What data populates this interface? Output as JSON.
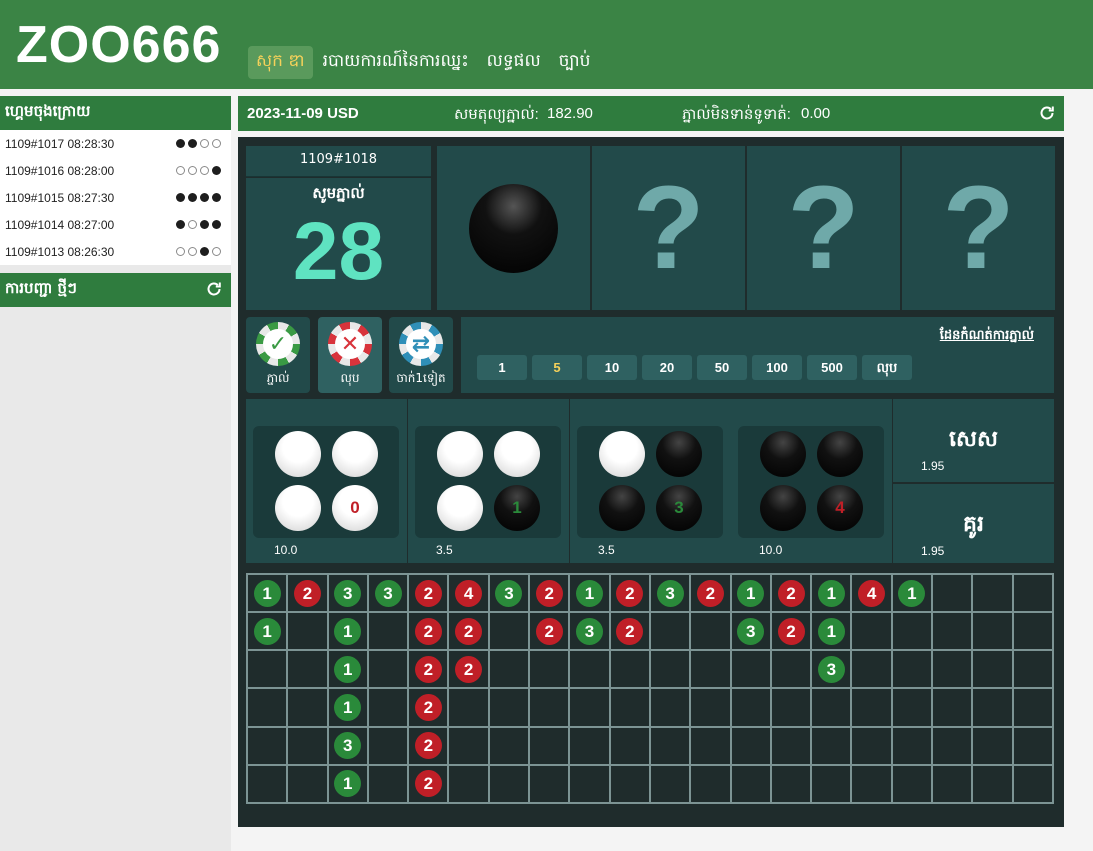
{
  "header": {
    "logo": "ZOO666",
    "nav": [
      {
        "label": "សុក ឌា",
        "active": true
      },
      {
        "label": "របាយការណ៍នៃការឈ្នះ",
        "active": false
      },
      {
        "label": "លទ្ធផល",
        "active": false
      },
      {
        "label": "ច្បាប់",
        "active": false
      }
    ]
  },
  "sidebar": {
    "recent_title": "ហ្គេមចុងក្រោយ",
    "recent": [
      {
        "id": "1109#1017 08:28:30",
        "dots": [
          "b",
          "b",
          "w",
          "w"
        ]
      },
      {
        "id": "1109#1016 08:28:00",
        "dots": [
          "w",
          "w",
          "w",
          "b"
        ]
      },
      {
        "id": "1109#1015 08:27:30",
        "dots": [
          "b",
          "b",
          "b",
          "b"
        ]
      },
      {
        "id": "1109#1014 08:27:00",
        "dots": [
          "b",
          "w",
          "b",
          "b"
        ]
      },
      {
        "id": "1109#1013 08:26:30",
        "dots": [
          "w",
          "w",
          "b",
          "w"
        ]
      }
    ],
    "orders_title": "ការបញ្ជា ថ្មីៗ"
  },
  "topbar": {
    "date_currency": "2023-11-09 USD",
    "balance_label": "សមតុល្យភ្នាល់:",
    "balance_value": "182.90",
    "unsettled_label": "ភ្នាល់មិនទាន់ទូទាត់:",
    "unsettled_value": "0.00"
  },
  "round": {
    "id": "1109#1018",
    "countdown_label": "សូមភ្នាល់",
    "countdown": "28",
    "slots": [
      "black",
      "?",
      "?",
      "?"
    ]
  },
  "actions": [
    {
      "label": "ភ្នាល់",
      "icon": "check-icon"
    },
    {
      "label": "លុប",
      "icon": "cross-icon"
    },
    {
      "label": "ចាក់1ទៀត",
      "icon": "repeat-icon"
    }
  ],
  "bet": {
    "limit_label": "ដែនកំណត់ការភ្នាល់",
    "amounts": [
      "1",
      "5",
      "10",
      "20",
      "50",
      "100",
      "500",
      "លុប"
    ],
    "selected": "5"
  },
  "options": [
    {
      "balls": [
        "w",
        "w",
        "w",
        "w"
      ],
      "count": "0",
      "count_color": "#c01f27",
      "odds": "10.0"
    },
    {
      "balls": [
        "w",
        "w",
        "w",
        "b"
      ],
      "count": "1",
      "count_color": "#2a8a3a",
      "odds": "3.5"
    },
    {
      "balls": [
        "w",
        "b",
        "b",
        "b"
      ],
      "count": "3",
      "count_color": "#2a8a3a",
      "odds": "3.5"
    },
    {
      "balls": [
        "b",
        "b",
        "b",
        "b"
      ],
      "count": "4",
      "count_color": "#c01f27",
      "odds": "10.0"
    }
  ],
  "odd_even": [
    {
      "label": "សេស",
      "odds": "1.95"
    },
    {
      "label": "គូរ",
      "odds": "1.95"
    }
  ],
  "road": [
    [
      {
        "v": "1",
        "c": "g"
      },
      {
        "v": "2",
        "c": "r"
      },
      {
        "v": "3",
        "c": "g"
      },
      {
        "v": "3",
        "c": "g"
      },
      {
        "v": "2",
        "c": "r"
      },
      {
        "v": "4",
        "c": "r"
      },
      {
        "v": "3",
        "c": "g"
      },
      {
        "v": "2",
        "c": "r"
      },
      {
        "v": "1",
        "c": "g"
      },
      {
        "v": "2",
        "c": "r"
      },
      {
        "v": "3",
        "c": "g"
      },
      {
        "v": "2",
        "c": "r"
      },
      {
        "v": "1",
        "c": "g"
      },
      {
        "v": "2",
        "c": "r"
      },
      {
        "v": "1",
        "c": "g"
      },
      {
        "v": "4",
        "c": "r"
      },
      {
        "v": "1",
        "c": "g"
      },
      null,
      null,
      null
    ],
    [
      {
        "v": "1",
        "c": "g"
      },
      null,
      {
        "v": "1",
        "c": "g"
      },
      null,
      {
        "v": "2",
        "c": "r"
      },
      {
        "v": "2",
        "c": "r"
      },
      null,
      {
        "v": "2",
        "c": "r"
      },
      {
        "v": "3",
        "c": "g"
      },
      {
        "v": "2",
        "c": "r"
      },
      null,
      null,
      {
        "v": "3",
        "c": "g"
      },
      {
        "v": "2",
        "c": "r"
      },
      {
        "v": "1",
        "c": "g"
      },
      null,
      null,
      null,
      null,
      null
    ],
    [
      null,
      null,
      {
        "v": "1",
        "c": "g"
      },
      null,
      {
        "v": "2",
        "c": "r"
      },
      {
        "v": "2",
        "c": "r"
      },
      null,
      null,
      null,
      null,
      null,
      null,
      null,
      null,
      {
        "v": "3",
        "c": "g"
      },
      null,
      null,
      null,
      null,
      null
    ],
    [
      null,
      null,
      {
        "v": "1",
        "c": "g"
      },
      null,
      {
        "v": "2",
        "c": "r"
      },
      null,
      null,
      null,
      null,
      null,
      null,
      null,
      null,
      null,
      null,
      null,
      null,
      null,
      null,
      null
    ],
    [
      null,
      null,
      {
        "v": "3",
        "c": "g"
      },
      null,
      {
        "v": "2",
        "c": "r"
      },
      null,
      null,
      null,
      null,
      null,
      null,
      null,
      null,
      null,
      null,
      null,
      null,
      null,
      null,
      null
    ],
    [
      null,
      null,
      {
        "v": "1",
        "c": "g"
      },
      null,
      {
        "v": "2",
        "c": "r"
      },
      null,
      null,
      null,
      null,
      null,
      null,
      null,
      null,
      null,
      null,
      null,
      null,
      null,
      null,
      null
    ]
  ]
}
